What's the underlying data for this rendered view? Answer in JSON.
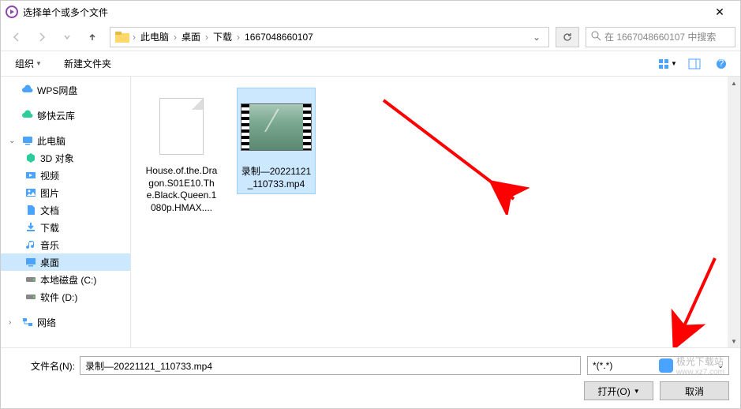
{
  "window": {
    "title": "选择单个或多个文件",
    "close": "✕"
  },
  "nav": {
    "crumbs": [
      "此电脑",
      "桌面",
      "下载",
      "1667048660107"
    ],
    "search_placeholder": "在 1667048660107 中搜索"
  },
  "toolbar": {
    "organize": "组织",
    "new_folder": "新建文件夹"
  },
  "sidebar": {
    "wps": "WPS网盘",
    "gouku": "够快云库",
    "this_pc": "此电脑",
    "objects3d": "3D 对象",
    "videos": "视频",
    "pictures": "图片",
    "documents": "文档",
    "downloads": "下载",
    "music": "音乐",
    "desktop": "桌面",
    "disk_c": "本地磁盘 (C:)",
    "disk_d": "软件 (D:)",
    "network": "网络"
  },
  "files": [
    {
      "name": "House.of.the.Dragon.S01E10.The.Black.Queen.1080p.HMAX....",
      "type": "document",
      "selected": false
    },
    {
      "name": "录制—20221121_110733.mp4",
      "type": "video",
      "selected": true
    }
  ],
  "bottom": {
    "filename_label": "文件名(N):",
    "filename_value": "录制—20221121_110733.mp4",
    "filter": "*(*.*)",
    "open": "打开(O)",
    "cancel": "取消"
  },
  "watermark": {
    "text": "极光下载站",
    "url": "www.xz7.com"
  }
}
